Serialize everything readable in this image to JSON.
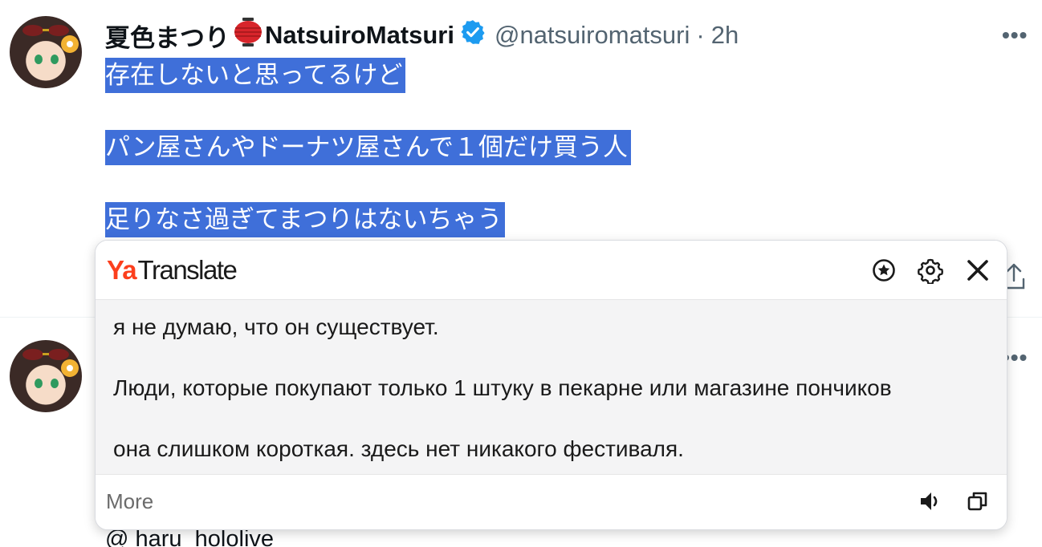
{
  "tweet1": {
    "display_name": "夏色まつり",
    "display_name_latin": "NatsuiroMatsuri",
    "handle": "@natsuiromatsuri",
    "separator": "·",
    "time": "2h",
    "more": "•••",
    "lines": [
      "存在しないと思ってるけど",
      "パン屋さんやドーナツ屋さんで１個だけ買う人",
      "足りなさ過ぎてまつりはないちゃう"
    ]
  },
  "tweet2": {
    "more": "•••",
    "mention": "@ haru_hololive"
  },
  "translate": {
    "brand_ya": "Ya",
    "brand_name": "Translate",
    "lines": [
      "я не думаю, что он существует.",
      "Люди, которые покупают только 1 штуку в пекарне или магазине пончиков",
      "она слишком короткая. здесь нет никакого фестиваля."
    ],
    "more_label": "More",
    "icons": {
      "favorite": "star-circle-icon",
      "settings": "gear-icon",
      "close": "close-icon",
      "speak": "speaker-icon",
      "copy": "copy-icon"
    }
  },
  "colors": {
    "selection": "#3f6fd9",
    "verified": "#1d9bf0",
    "yandex_red": "#fc3f1d",
    "muted": "#536471"
  }
}
